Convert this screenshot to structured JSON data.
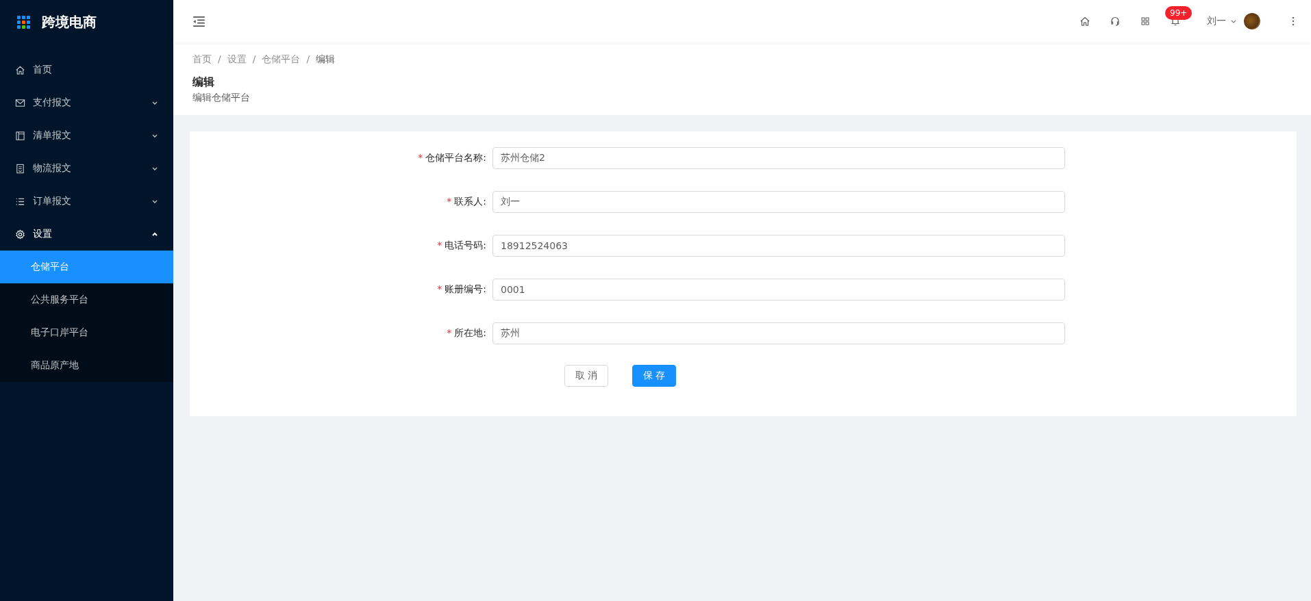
{
  "sidebar": {
    "logo_text": "跨境电商",
    "menu": [
      {
        "label": "首页"
      },
      {
        "label": "支付报文",
        "expanded": false
      },
      {
        "label": "清单报文",
        "expanded": false
      },
      {
        "label": "物流报文",
        "expanded": false
      },
      {
        "label": "订单报文",
        "expanded": false
      },
      {
        "label": "设置",
        "expanded": true,
        "children": [
          {
            "label": "仓储平台",
            "selected": true
          },
          {
            "label": "公共服务平台",
            "selected": false
          },
          {
            "label": "电子口岸平台",
            "selected": false
          },
          {
            "label": "商品原产地",
            "selected": false
          }
        ]
      }
    ]
  },
  "header": {
    "notification_badge": "99+",
    "user_name": "刘一"
  },
  "breadcrumb": [
    "首页",
    "设置",
    "仓储平台",
    "编辑"
  ],
  "breadcrumb_separator": "/",
  "page_title": "编辑",
  "page_subtitle": "编辑仓储平台",
  "form": {
    "fields": [
      {
        "required_mark": "*",
        "label": "仓储平台名称:",
        "value": "苏州仓储2"
      },
      {
        "required_mark": "*",
        "label": "联系人:",
        "value": "刘一"
      },
      {
        "required_mark": "*",
        "label": "电话号码:",
        "value": "18912524063"
      },
      {
        "required_mark": "*",
        "label": "账册编号:",
        "value": "0001"
      },
      {
        "required_mark": "*",
        "label": "所在地:",
        "value": "苏州"
      }
    ],
    "buttons": [
      {
        "label": "取 消",
        "kind": "default"
      },
      {
        "label": "保 存",
        "kind": "primary"
      }
    ]
  }
}
